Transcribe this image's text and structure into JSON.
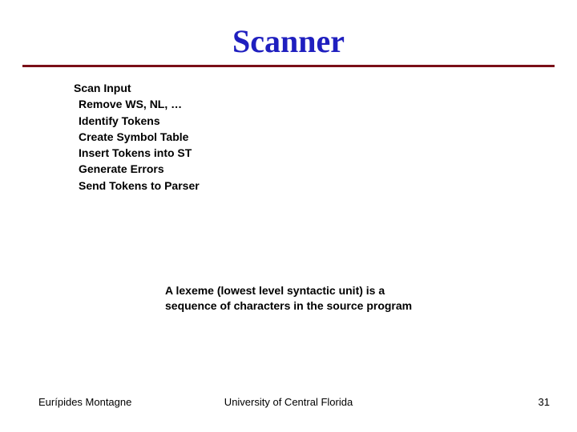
{
  "title": "Scanner",
  "list": {
    "header": "Scan Input",
    "items": [
      "Remove WS, NL, …",
      "Identify Tokens",
      "Create Symbol Table",
      "Insert Tokens into ST",
      "Generate Errors",
      "Send Tokens to Parser"
    ]
  },
  "definition": "A lexeme (lowest level syntactic unit) is a sequence of characters in the source program",
  "footer": {
    "author": "Eurípides Montagne",
    "affiliation": "University of Central Florida",
    "page": "31"
  }
}
